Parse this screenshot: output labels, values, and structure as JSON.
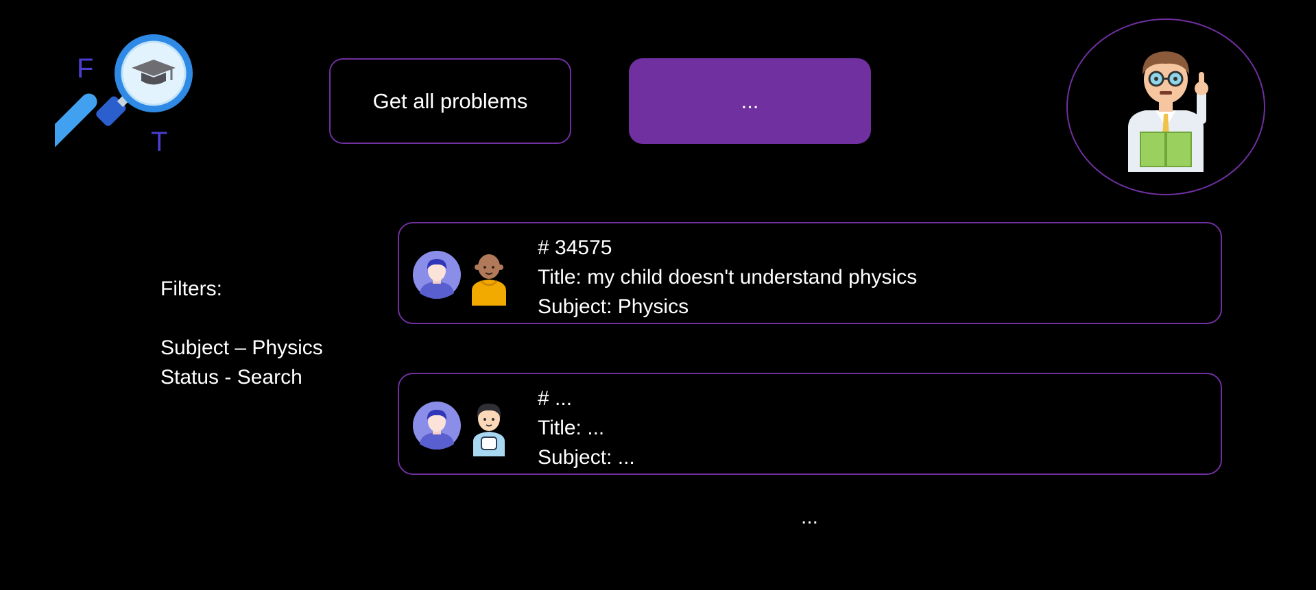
{
  "logo": {
    "letter_left": "F",
    "letter_right": "T",
    "icon": "magnifier-graduation-cap-icon",
    "accent": "#4a3fd0"
  },
  "toolbar": {
    "get_all_label": "Get all problems",
    "second_label": "..."
  },
  "profile": {
    "icon": "teacher-avatar-icon"
  },
  "filters": {
    "heading": "Filters:",
    "items": [
      "Subject – Physics",
      "Status - Search"
    ]
  },
  "problems": [
    {
      "number": "# 34575",
      "title": "Title: my child doesn't understand physics",
      "subject": "Subject: Physics",
      "parent_icon": "parent-avatar-icon",
      "child_icon": "child-avatar-icon"
    },
    {
      "number": "# ...",
      "title": "Title: ...",
      "subject": "Subject: ...",
      "parent_icon": "parent-avatar-icon",
      "child_icon": "child-avatar-icon"
    }
  ],
  "more_label": "...",
  "colors": {
    "accent": "#7030a0",
    "background": "#000000",
    "text": "#ffffff"
  }
}
